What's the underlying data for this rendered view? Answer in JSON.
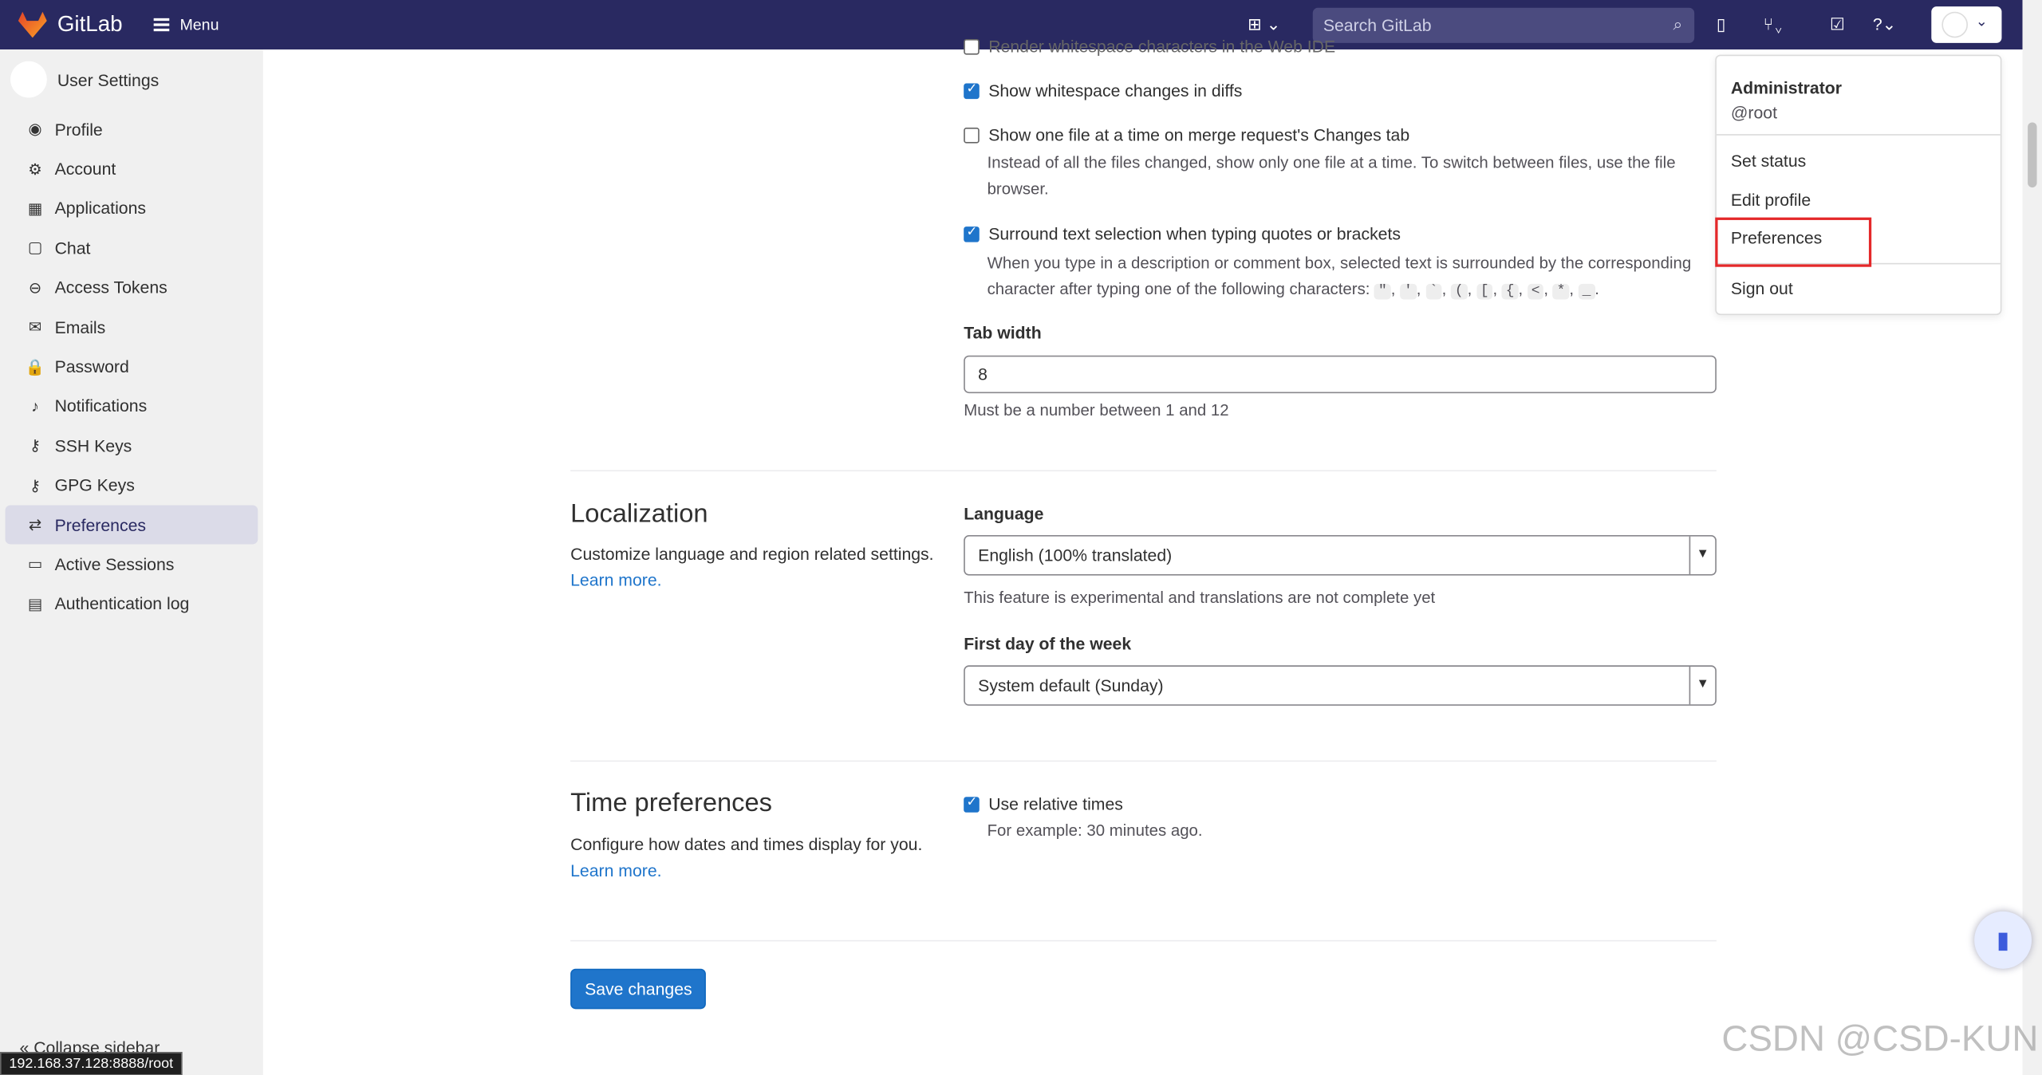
{
  "topbar": {
    "brand": "GitLab",
    "menu": "Menu",
    "search_placeholder": "Search GitLab"
  },
  "sidebar": {
    "title": "User Settings",
    "items": [
      {
        "label": "Profile",
        "icon": "profile-icon",
        "glyph": "◉"
      },
      {
        "label": "Account",
        "icon": "account-icon",
        "glyph": "⚙"
      },
      {
        "label": "Applications",
        "icon": "applications-icon",
        "glyph": "▦"
      },
      {
        "label": "Chat",
        "icon": "chat-icon",
        "glyph": "▢"
      },
      {
        "label": "Access Tokens",
        "icon": "token-icon",
        "glyph": "⊖"
      },
      {
        "label": "Emails",
        "icon": "mail-icon",
        "glyph": "✉"
      },
      {
        "label": "Password",
        "icon": "lock-icon",
        "glyph": "🔒"
      },
      {
        "label": "Notifications",
        "icon": "bell-icon",
        "glyph": "♪"
      },
      {
        "label": "SSH Keys",
        "icon": "key-icon",
        "glyph": "⚷"
      },
      {
        "label": "GPG Keys",
        "icon": "key-icon",
        "glyph": "⚷"
      },
      {
        "label": "Preferences",
        "icon": "preferences-icon",
        "glyph": "⇄"
      },
      {
        "label": "Active Sessions",
        "icon": "monitor-icon",
        "glyph": "▭"
      },
      {
        "label": "Authentication log",
        "icon": "log-icon",
        "glyph": "▤"
      }
    ],
    "active": "Preferences",
    "collapse": "Collapse sidebar"
  },
  "status_url": "192.168.37.128:8888/root",
  "behavior": {
    "cut_option": "Render whitespace characters in the Web IDE",
    "whitespace": {
      "label": "Show whitespace changes in diffs",
      "checked": true
    },
    "one_file": {
      "label": "Show one file at a time on merge request's Changes tab",
      "checked": false,
      "help": "Instead of all the files changed, show only one file at a time. To switch between files, use the file browser."
    },
    "surround": {
      "label": "Surround text selection when typing quotes or brackets",
      "checked": true,
      "help": "When you type in a description or comment box, selected text is surrounded by the corresponding character after typing one of the following characters:",
      "chars": [
        "\"",
        "'",
        "`",
        "(",
        "[",
        "{",
        "<",
        "*",
        "_"
      ]
    },
    "tab_width": {
      "label": "Tab width",
      "value": "8",
      "help": "Must be a number between 1 and 12"
    }
  },
  "localization": {
    "title": "Localization",
    "desc": "Customize language and region related settings.",
    "learn": "Learn more.",
    "language_label": "Language",
    "language": "English (100% translated)",
    "language_help": "This feature is experimental and translations are not complete yet",
    "week_label": "First day of the week",
    "week": "System default (Sunday)"
  },
  "time": {
    "title": "Time preferences",
    "desc": "Configure how dates and times display for you.",
    "learn": "Learn more.",
    "relative": {
      "label": "Use relative times",
      "checked": true
    },
    "example": "For example: 30 minutes ago."
  },
  "save": "Save changes",
  "user_menu": {
    "name": "Administrator",
    "handle": "@root",
    "items": [
      "Set status",
      "Edit profile",
      "Preferences",
      "Sign out"
    ],
    "highlighted": "Preferences"
  },
  "watermark": "CSDN @CSD-KUN"
}
